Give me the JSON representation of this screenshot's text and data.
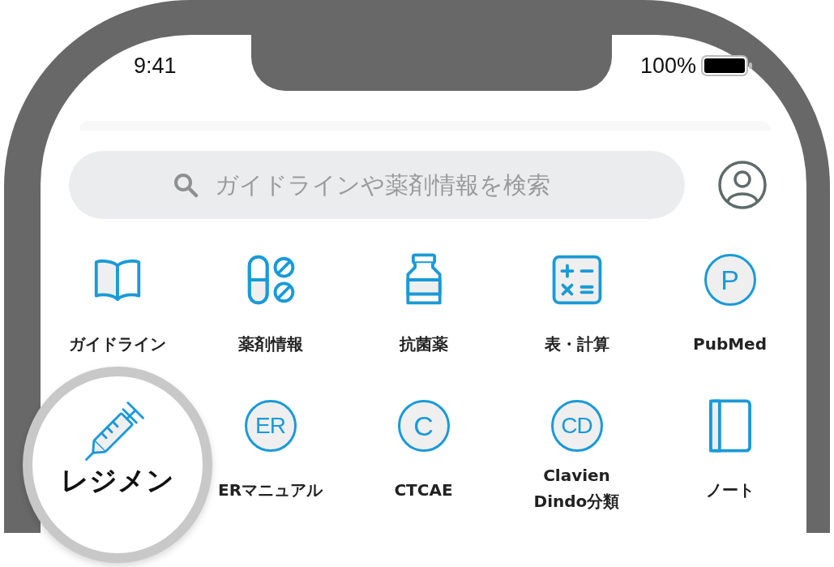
{
  "status_bar": {
    "time": "9:41",
    "battery": "100%"
  },
  "search": {
    "placeholder": "ガイドラインや薬剤情報を検索"
  },
  "menu": [
    {
      "label": "ガイドライン",
      "kind": "book",
      "highlighted": false
    },
    {
      "label": "薬剤情報",
      "kind": "pills",
      "highlighted": false
    },
    {
      "label": "抗菌薬",
      "kind": "bottle",
      "highlighted": false
    },
    {
      "label": "表・計算",
      "kind": "calculator",
      "highlighted": false
    },
    {
      "label": "PubMed",
      "kind": "letter",
      "letters": "P",
      "highlighted": false
    },
    {
      "label": "レジメン",
      "kind": "syringe",
      "highlighted": true
    },
    {
      "label": "ERマニュアル",
      "kind": "letter",
      "letters": "ER",
      "highlighted": false
    },
    {
      "label": "CTCAE",
      "kind": "letter",
      "letters": "C",
      "highlighted": false
    },
    {
      "label": "Clavien Dindo分類",
      "kind": "letter",
      "letters": "CD",
      "highlighted": false
    },
    {
      "label": "ノート",
      "kind": "notebook",
      "highlighted": false
    }
  ]
}
